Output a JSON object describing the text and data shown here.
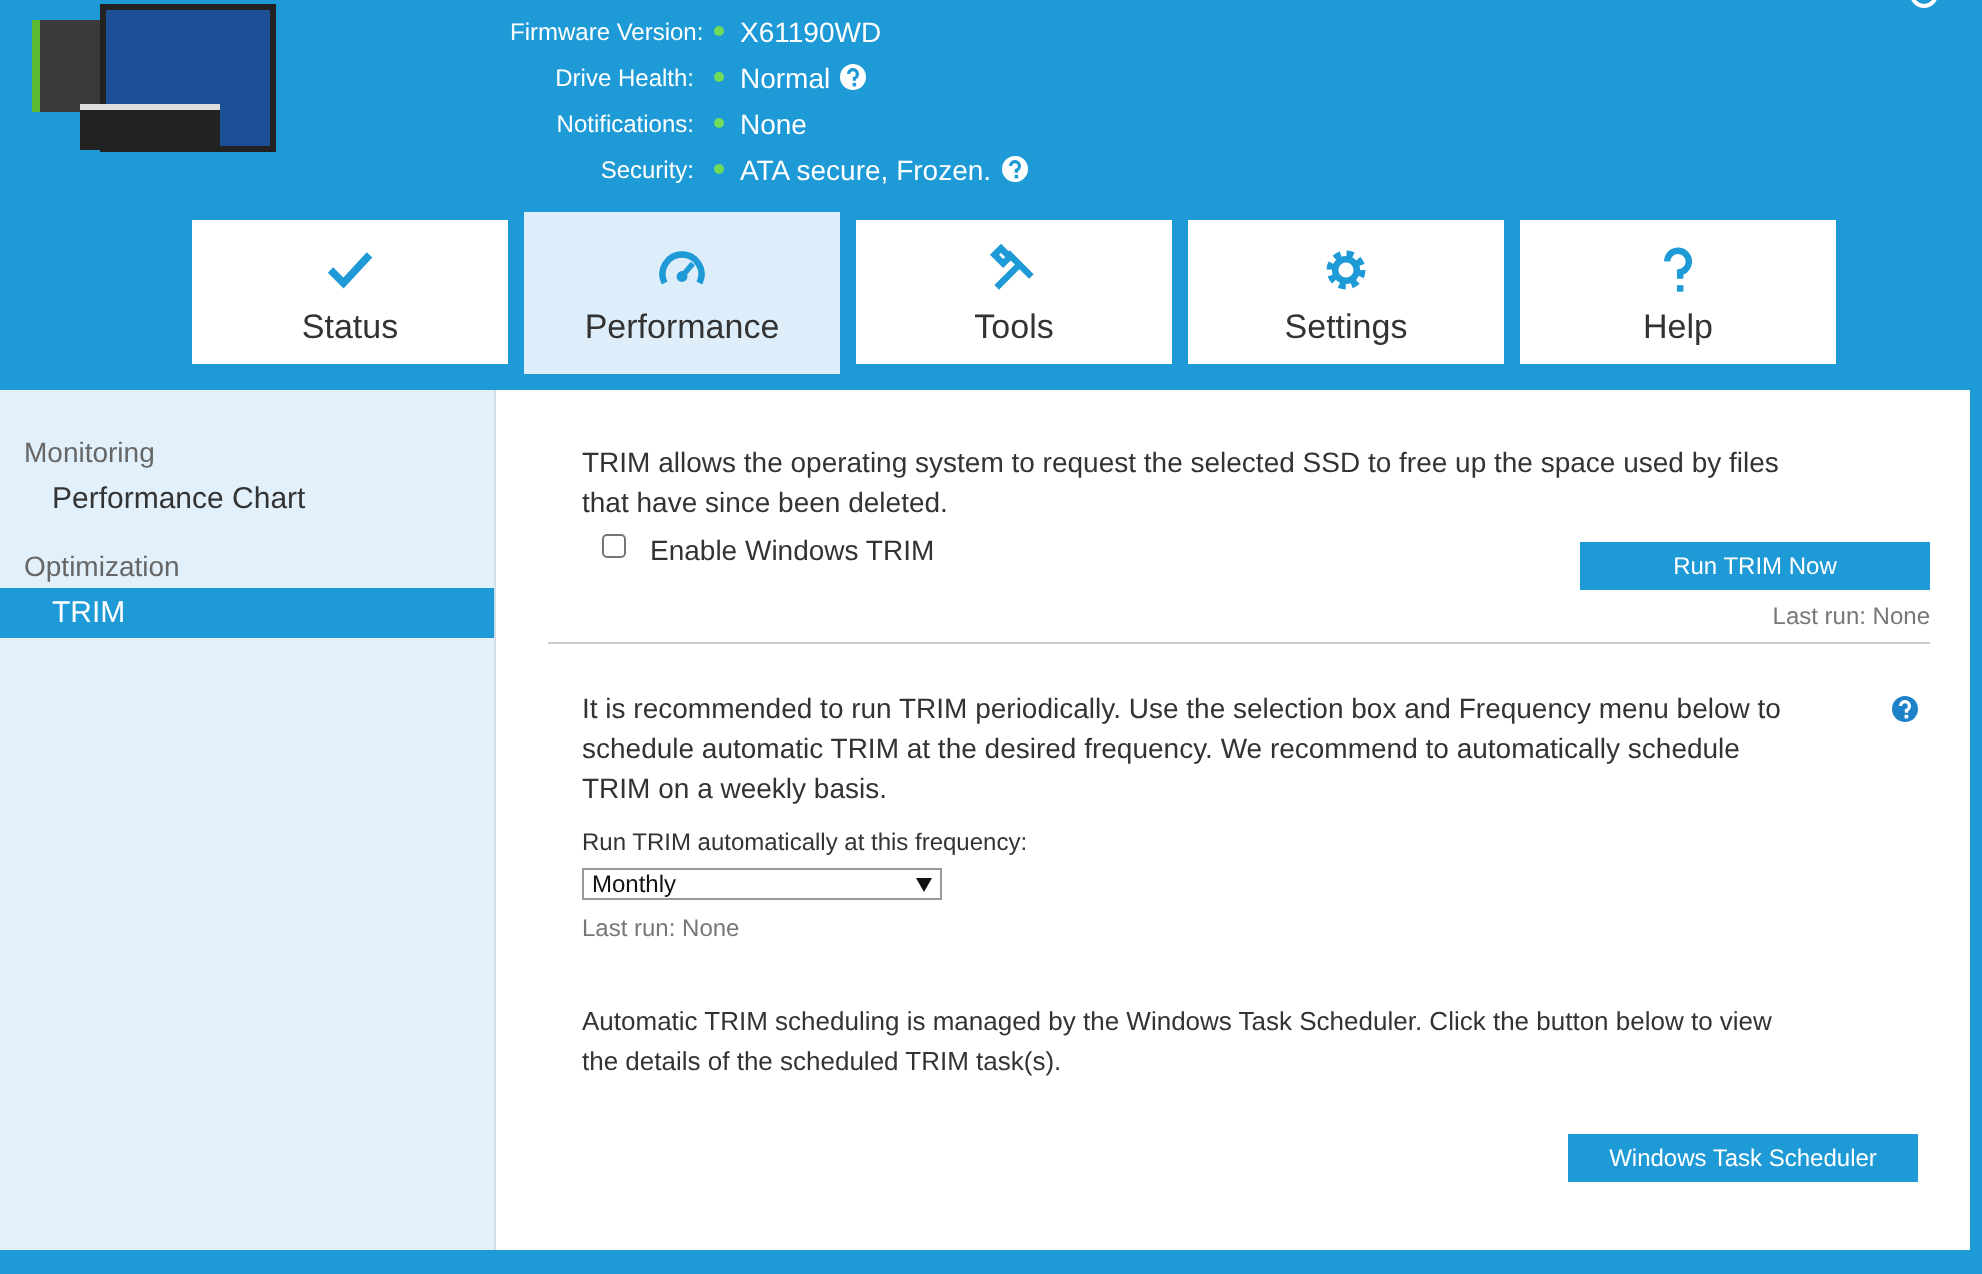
{
  "drive_info": [
    {
      "label": "Firmware Version:",
      "value": "X61190WD",
      "help": false
    },
    {
      "label": "Drive Health:",
      "value": "Normal",
      "help": true
    },
    {
      "label": "Notifications:",
      "value": "None",
      "help": false
    },
    {
      "label": "Security:",
      "value": "ATA secure, Frozen.",
      "help": true
    }
  ],
  "tabs": [
    {
      "label": "Status",
      "selected": false
    },
    {
      "label": "Performance",
      "selected": true
    },
    {
      "label": "Tools",
      "selected": false
    },
    {
      "label": "Settings",
      "selected": false
    },
    {
      "label": "Help",
      "selected": false
    }
  ],
  "sidebar": {
    "sections": [
      {
        "title": "Monitoring",
        "items": [
          {
            "label": "Performance Chart",
            "selected": false
          }
        ]
      },
      {
        "title": "Optimization",
        "items": [
          {
            "label": "TRIM",
            "selected": true
          }
        ]
      }
    ]
  },
  "trim": {
    "description": "TRIM allows the operating system to request the selected SSD to free up the space used by files that have since been deleted.",
    "enable_checkbox": {
      "label": "Enable Windows TRIM",
      "checked": false
    },
    "run_button": "Run TRIM Now",
    "last_run": "Last run: None"
  },
  "schedule": {
    "description": "It is recommended to run TRIM periodically. Use the selection box and Frequency menu below to schedule automatic TRIM at the desired frequency. We recommend to automatically schedule TRIM on a weekly basis.",
    "frequency_label": "Run TRIM automatically at this frequency:",
    "frequency_value": "Monthly",
    "last_run": "Last run: None",
    "scheduler_note": "Automatic TRIM scheduling is managed by the Windows Task Scheduler. Click the button below to view the details of the scheduled TRIM task(s).",
    "scheduler_button": "Windows Task Scheduler"
  }
}
